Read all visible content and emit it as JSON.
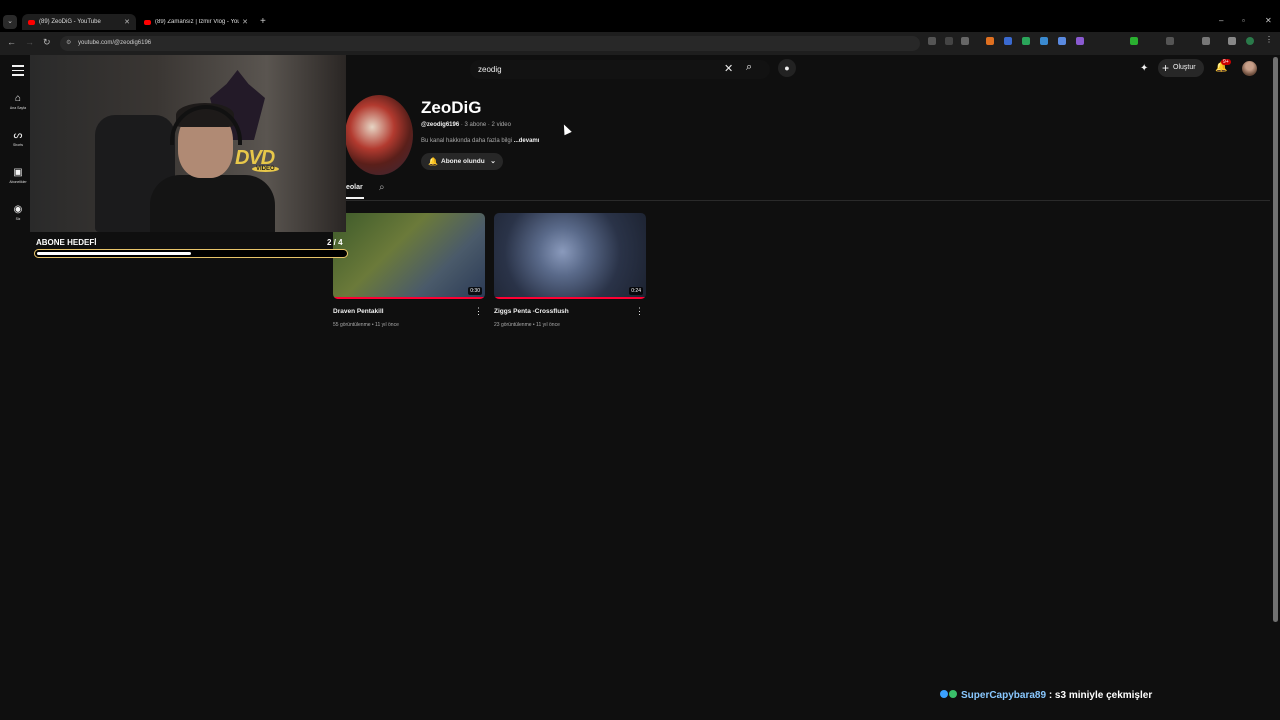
{
  "browser": {
    "tabs": [
      {
        "title": "(89) ZeoDiG - YouTube",
        "active": true
      },
      {
        "title": "(89) Zamansız | İzmir Vlog - You",
        "active": false
      }
    ],
    "url": "youtube.com/@zeodig6196"
  },
  "youtube": {
    "sidebar": [
      {
        "label": "Ana Sayfa",
        "icon": "home-icon"
      },
      {
        "label": "Shorts",
        "icon": "shorts-icon"
      },
      {
        "label": "Abonelikler",
        "icon": "subscriptions-icon"
      },
      {
        "label": "Siz",
        "icon": "you-icon"
      }
    ],
    "search_value": "zeodig",
    "create_label": "Oluştur",
    "notifications_badge": "9+",
    "channel": {
      "name": "ZeoDiG",
      "handle": "@zeodig6196",
      "meta": "· 3 abone · 2 video",
      "description": "Bu kanal hakkında daha fazla bilgi",
      "description_more": "...devamı",
      "subscribe_label": "Abone olundu",
      "tab_videos": "eolar"
    },
    "videos": [
      {
        "title": "Draven Pentakill",
        "duration": "0:30",
        "meta": "55 görüntülenme • 11 yıl önce",
        "thumb_colors": [
          "#3d5a2a",
          "#6b7a3a",
          "#2b3a55"
        ]
      },
      {
        "title": "Ziggs Penta -Crossflush",
        "duration": "0:24",
        "meta": "23 görüntülenme • 11 yıl önce",
        "thumb_colors": [
          "#2a3348",
          "#5a6a8a",
          "#1c2230"
        ]
      }
    ]
  },
  "overlay": {
    "goal_label": "ABONE HEDEFİ",
    "goal_count": "2 / 4",
    "goal_progress": 0.5,
    "dvd_text": "DVD",
    "dvd_sub": "VIDEO",
    "chat_user": "SuperCapybara89",
    "chat_message": ": s3 miniyle çekmişler"
  },
  "colors": {
    "accent": "#ff0033",
    "goal_border": "#e8c46a",
    "dvd": "#e8c84a",
    "chat_user": "#89c8ff"
  }
}
